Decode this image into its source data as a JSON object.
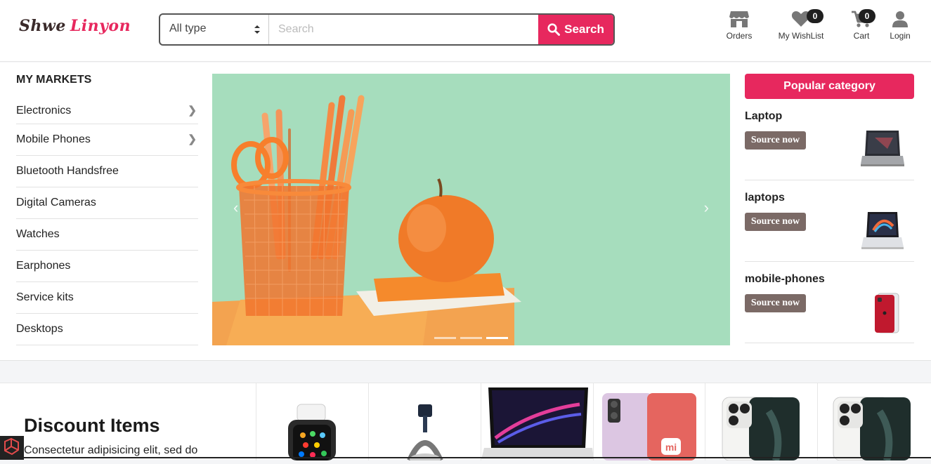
{
  "brand": {
    "name_part1": "Shwe",
    "name_part2": "Linyon"
  },
  "search": {
    "type_value": "All type",
    "placeholder": "Search",
    "button_label": "Search"
  },
  "header_icons": {
    "orders": {
      "label": "Orders"
    },
    "wishlist": {
      "label": "My WishList",
      "count": "0"
    },
    "cart": {
      "label": "Cart",
      "count": "0"
    },
    "login": {
      "label": "Login"
    }
  },
  "markets": {
    "title": "MY MARKETS",
    "items": [
      {
        "label": "Electronics",
        "has_submenu": true
      },
      {
        "label": "Mobile Phones",
        "has_submenu": true
      },
      {
        "label": "Bluetooth Handsfree",
        "has_submenu": false
      },
      {
        "label": "Digital Cameras",
        "has_submenu": false
      },
      {
        "label": "Watches",
        "has_submenu": false
      },
      {
        "label": "Earphones",
        "has_submenu": false
      },
      {
        "label": "Service kits",
        "has_submenu": false
      },
      {
        "label": "Desktops",
        "has_submenu": false
      }
    ]
  },
  "carousel": {
    "prev_icon": "‹",
    "next_icon": "›",
    "slide_count": 3,
    "active_slide": 3
  },
  "popular": {
    "title": "Popular category",
    "items": [
      {
        "name": "Laptop",
        "button": "Source now",
        "image": "laptop-icon"
      },
      {
        "name": "laptops",
        "button": "Source now",
        "image": "laptop-icon"
      },
      {
        "name": "mobile-phones",
        "button": "Source now",
        "image": "phone-icon"
      }
    ]
  },
  "discount": {
    "title": "Discount Items",
    "text": "Consectetur adipisicing elit, sed do",
    "products": [
      "smartwatch-icon",
      "headphones-icon",
      "laptop-icon",
      "phone-icon",
      "phone-icon",
      "phone-icon"
    ]
  },
  "colors": {
    "accent": "#e7285e",
    "source_button": "#7b6a66",
    "carousel_bg": "#a6ddbd"
  }
}
